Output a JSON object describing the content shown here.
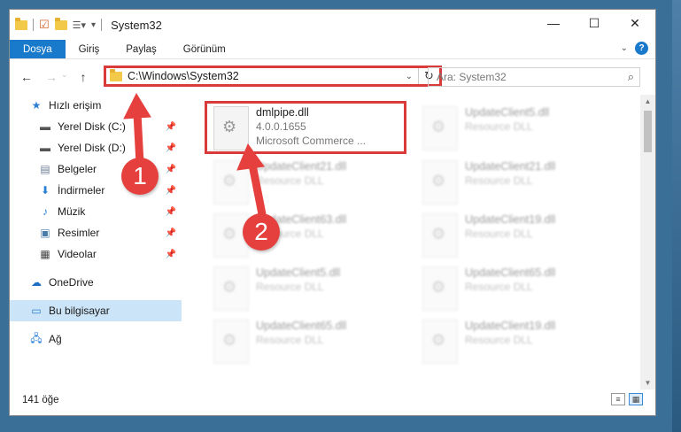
{
  "window": {
    "title": "System32",
    "controls": [
      "—",
      "☐",
      "✕"
    ]
  },
  "ribbon": {
    "tabs": [
      "Dosya",
      "Giriş",
      "Paylaş",
      "Görünüm"
    ]
  },
  "address": {
    "path": "C:\\Windows\\System32",
    "search_placeholder": "Ara: System32"
  },
  "sidebar": {
    "quick_access": "Hızlı erişim",
    "items": [
      {
        "label": "Yerel Disk (C:)",
        "icon": "drive-icon"
      },
      {
        "label": "Yerel Disk (D:)",
        "icon": "drive-icon"
      },
      {
        "label": "Belgeler",
        "icon": "documents-icon"
      },
      {
        "label": "İndirmeler",
        "icon": "download-icon"
      },
      {
        "label": "Müzik",
        "icon": "music-icon"
      },
      {
        "label": "Resimler",
        "icon": "pictures-icon"
      },
      {
        "label": "Videolar",
        "icon": "videos-icon"
      }
    ],
    "onedrive": "OneDrive",
    "this_pc": "Bu bilgisayar",
    "network": "Ağ"
  },
  "files": {
    "selected": {
      "name": "dmlpipe.dll",
      "version": "4.0.0.1655",
      "company": "Microsoft Commerce ..."
    },
    "others": [
      {
        "name": "UpdateClient5.dll",
        "type": "Resource DLL"
      },
      {
        "name": "UpdateClient21.dll",
        "type": "Resource DLL"
      },
      {
        "name": "UpdateClient21.dll",
        "type": "Resource DLL"
      },
      {
        "name": "UpdateClient63.dll",
        "type": "Resource DLL"
      },
      {
        "name": "UpdateClient19.dll",
        "type": "Resource DLL"
      },
      {
        "name": "UpdateClient5.dll",
        "type": "Resource DLL"
      },
      {
        "name": "UpdateClient65.dll",
        "type": "Resource DLL"
      },
      {
        "name": "UpdateClient65.dll",
        "type": "Resource DLL"
      },
      {
        "name": "UpdateClient19.dll",
        "type": "Resource DLL"
      }
    ]
  },
  "status": {
    "count": "141 öğe"
  },
  "annotations": {
    "step1": "1",
    "step2": "2"
  },
  "colors": {
    "accent": "#1979ca",
    "annotation_red": "#e5403d"
  }
}
